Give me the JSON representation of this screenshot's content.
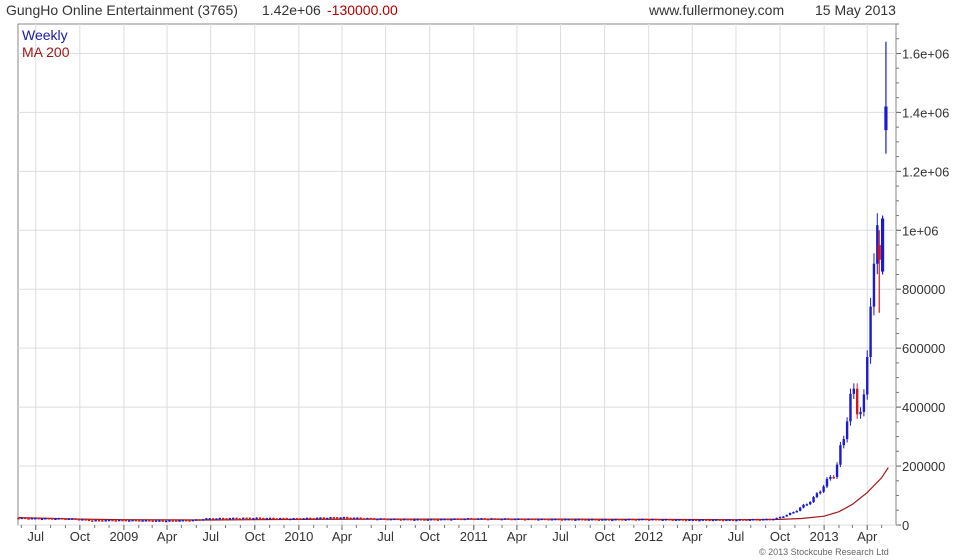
{
  "header": {
    "title": "GungHo Online Entertainment (3765)",
    "price": "1.42e+06",
    "change": "-130000.00",
    "site": "www.fullermoney.com",
    "date": "15 May 2013"
  },
  "footer": {
    "copyright": "© 2013 Stockcube Research Ltd"
  },
  "colors": {
    "up": "#1a1ad0",
    "down": "#d01818",
    "ma": "#a01818",
    "grid": "#dddddd"
  },
  "chart_data": {
    "type": "candlestick",
    "y_tick_labels": [
      "0",
      "200000",
      "400000",
      "600000",
      "800000",
      "1e+06",
      "1.2e+06",
      "1.4e+06",
      "1.6e+06"
    ],
    "y_tick_values": [
      0,
      200000,
      400000,
      600000,
      800000,
      1000000,
      1200000,
      1400000,
      1600000
    ],
    "ylim": [
      0,
      1700000
    ],
    "x_tick_labels": [
      "Jul",
      "Oct",
      "2009",
      "Apr",
      "Jul",
      "Oct",
      "2010",
      "Apr",
      "Jul",
      "Oct",
      "2011",
      "Apr",
      "Jul",
      "Oct",
      "2012",
      "Apr",
      "Jul",
      "Oct",
      "2013",
      "Apr"
    ],
    "x_tick_dates": [
      "2008-07-01",
      "2008-10-01",
      "2009-01-01",
      "2009-04-01",
      "2009-07-01",
      "2009-10-01",
      "2010-01-01",
      "2010-04-01",
      "2010-07-01",
      "2010-10-01",
      "2011-01-01",
      "2011-04-01",
      "2011-07-01",
      "2011-10-01",
      "2012-01-01",
      "2012-04-01",
      "2012-07-01",
      "2012-10-01",
      "2013-01-01",
      "2013-04-01"
    ],
    "xlim": [
      "2008-05-25",
      "2013-05-31"
    ],
    "legend": [
      {
        "name": "Weekly",
        "color": "#1a1aa6"
      },
      {
        "name": "MA 200",
        "color": "#a01818"
      }
    ],
    "legend_position": "top-left",
    "grid": true,
    "y_axis_side": "right",
    "series": [
      {
        "name": "Weekly",
        "kind": "ohlc",
        "weekly_close_points": [
          [
            "2008-05-26",
            24000
          ],
          [
            "2008-07-01",
            23000
          ],
          [
            "2008-09-01",
            22000
          ],
          [
            "2008-10-01",
            21000
          ],
          [
            "2008-11-01",
            16000
          ],
          [
            "2009-01-01",
            17000
          ],
          [
            "2009-04-01",
            15000
          ],
          [
            "2009-06-01",
            17000
          ],
          [
            "2009-07-01",
            22000
          ],
          [
            "2009-10-01",
            24000
          ],
          [
            "2010-01-01",
            22000
          ],
          [
            "2010-04-01",
            26000
          ],
          [
            "2010-07-01",
            21000
          ],
          [
            "2010-10-01",
            19000
          ],
          [
            "2011-01-01",
            22000
          ],
          [
            "2011-04-01",
            21000
          ],
          [
            "2011-07-01",
            20000
          ],
          [
            "2011-10-01",
            19000
          ],
          [
            "2012-01-01",
            20000
          ],
          [
            "2012-04-01",
            18000
          ],
          [
            "2012-07-01",
            18000
          ],
          [
            "2012-09-15",
            20000
          ],
          [
            "2012-10-01",
            23000
          ],
          [
            "2012-11-01",
            40000
          ],
          [
            "2012-12-01",
            70000
          ],
          [
            "2012-12-20",
            95000
          ],
          [
            "2013-01-05",
            130000
          ],
          [
            "2013-01-20",
            160000
          ],
          [
            "2013-02-01",
            180000
          ],
          [
            "2013-02-10",
            250000
          ],
          [
            "2013-02-20",
            310000
          ],
          [
            "2013-03-01",
            420000
          ],
          [
            "2013-03-10",
            450000
          ],
          [
            "2013-03-20",
            380000
          ],
          [
            "2013-04-01",
            420000
          ],
          [
            "2013-04-10",
            600000
          ],
          [
            "2013-04-18",
            900000
          ],
          [
            "2013-04-25",
            880000
          ],
          [
            "2013-05-01",
            1000000
          ],
          [
            "2013-05-15",
            1420000
          ]
        ],
        "recent_candles": [
          {
            "date": "2013-04-26",
            "open": 950000,
            "high": 1000000,
            "low": 720000,
            "close": 900000
          },
          {
            "date": "2013-05-03",
            "open": 860000,
            "high": 1050000,
            "low": 850000,
            "close": 1040000
          },
          {
            "date": "2013-05-10",
            "open": 1340000,
            "high": 1640000,
            "low": 1260000,
            "close": 1420000
          }
        ]
      },
      {
        "name": "MA 200",
        "kind": "line",
        "points": [
          [
            "2008-05-26",
            25000
          ],
          [
            "2008-10-01",
            20000
          ],
          [
            "2009-01-01",
            18000
          ],
          [
            "2009-07-01",
            17000
          ],
          [
            "2010-01-01",
            19000
          ],
          [
            "2010-07-01",
            20000
          ],
          [
            "2011-01-01",
            20000
          ],
          [
            "2011-07-01",
            20000
          ],
          [
            "2012-01-01",
            19000
          ],
          [
            "2012-07-01",
            18000
          ],
          [
            "2012-10-01",
            19000
          ],
          [
            "2012-11-15",
            22000
          ],
          [
            "2013-01-01",
            30000
          ],
          [
            "2013-02-01",
            45000
          ],
          [
            "2013-03-01",
            70000
          ],
          [
            "2013-04-01",
            110000
          ],
          [
            "2013-05-01",
            160000
          ],
          [
            "2013-05-15",
            195000
          ]
        ]
      }
    ]
  }
}
